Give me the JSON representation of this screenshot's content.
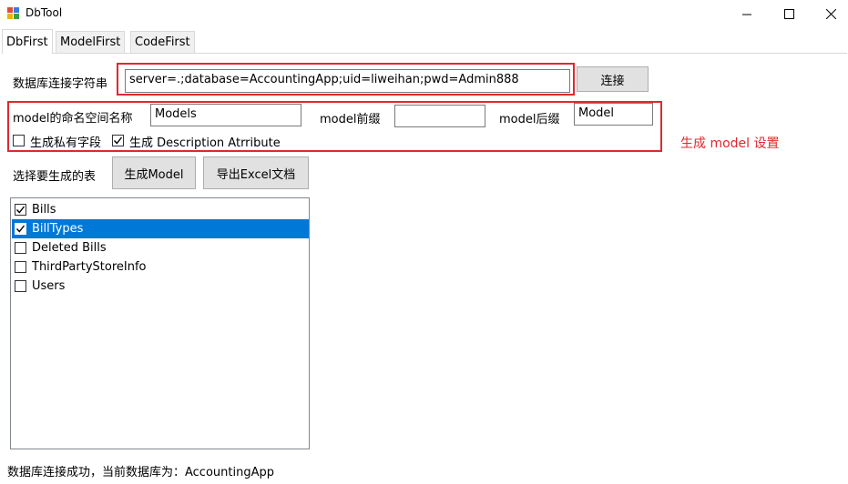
{
  "window": {
    "title": "DbTool",
    "controls": {
      "minimize_glyph": "—",
      "maximize_glyph": "☐",
      "close_glyph": "✕"
    }
  },
  "tabs": [
    {
      "label": "DbFirst",
      "active": true
    },
    {
      "label": "ModelFirst",
      "active": false
    },
    {
      "label": "CodeFirst",
      "active": false
    }
  ],
  "connection": {
    "label": "数据库连接字符串",
    "value": "server=.;database=AccountingApp;uid=liweihan;pwd=Admin888",
    "connect_button": "连接"
  },
  "model_settings": {
    "namespace_label": "model的命名空间名称",
    "namespace_value": "Models",
    "prefix_label": "model前缀",
    "prefix_value": "",
    "suffix_label": "model后缀",
    "suffix_value": "Model",
    "private_field_label": "生成私有字段",
    "private_field_checked": false,
    "description_label": "生成 Description Atrribute",
    "description_checked": true,
    "annotation": "生成 model 设置"
  },
  "tables": {
    "label": "选择要生成的表",
    "generate_button": "生成Model",
    "export_button": "导出Excel文档",
    "items": [
      {
        "name": "Bills",
        "checked": true,
        "selected": false
      },
      {
        "name": "BillTypes",
        "checked": true,
        "selected": true
      },
      {
        "name": "Deleted Bills",
        "checked": false,
        "selected": false
      },
      {
        "name": "ThirdPartyStoreInfo",
        "checked": false,
        "selected": false
      },
      {
        "name": "Users",
        "checked": false,
        "selected": false
      }
    ]
  },
  "status": {
    "text": "数据库连接成功，当前数据库为：AccountingApp"
  },
  "colors": {
    "highlight_red": "#e0282e",
    "selection_blue": "#0078d7"
  }
}
